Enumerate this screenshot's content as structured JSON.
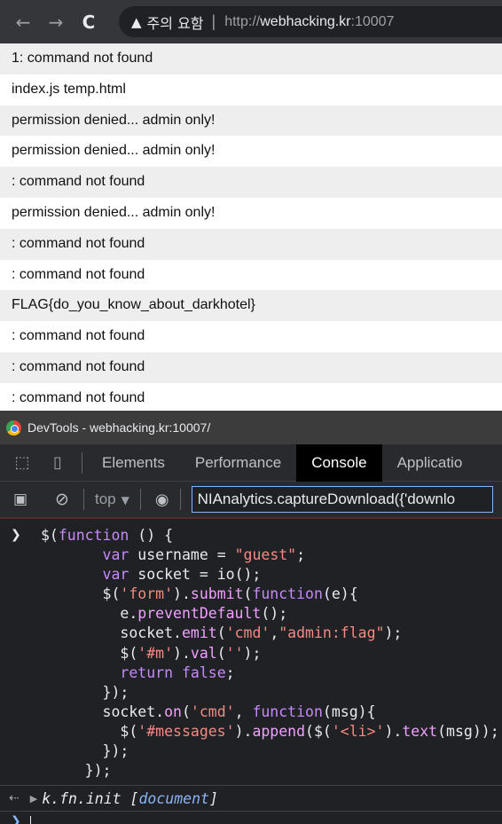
{
  "browser": {
    "back_icon": "←",
    "forward_icon": "→",
    "reload_icon": "C",
    "security_icon": "▲",
    "security_text": "주의 요함",
    "url_scheme": "http://",
    "url_host": "webhacking.kr",
    "url_port": ":10007"
  },
  "messages": [
    "1: command not found",
    "index.js temp.html",
    "permission denied... admin only!",
    "permission denied... admin only!",
    ": command not found",
    "permission denied... admin only!",
    ": command not found",
    ": command not found",
    "FLAG{do_you_know_about_darkhotel}",
    ": command not found",
    ": command not found",
    ": command not found"
  ],
  "devtools": {
    "title": "DevTools - webhacking.kr:10007/",
    "tabs": [
      "Elements",
      "Performance",
      "Console",
      "Applicatio"
    ],
    "active_tab": "Console",
    "context": "top",
    "filter_value": "NIAnalytics.captureDownload({'downlo"
  },
  "console": {
    "result_prefix": "k.fn.init [",
    "result_doc": "document",
    "result_suffix": "]"
  },
  "colors": {
    "keyword": "#c58af9",
    "string": "#f28b82",
    "active_tab_bg": "#000000"
  }
}
